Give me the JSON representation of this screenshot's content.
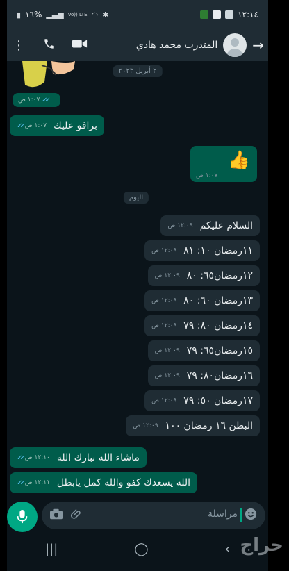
{
  "status_bar": {
    "time": "١٢:١٤",
    "battery": "١٦%",
    "network": "Vo)) LTE",
    "left_icons": [
      "battery-icon",
      "signal-icon",
      "wifi-icon",
      "bluetooth-icon"
    ],
    "right_icons": [
      "app-icon",
      "youtube-icon",
      "gallery-icon"
    ]
  },
  "header": {
    "contact_name": "المتدرب محمد هادي",
    "icons": [
      "menu-icon",
      "phone-icon",
      "video-icon",
      "back-arrow-icon"
    ]
  },
  "chat": {
    "date_chip_1": "٢ أبريل ٢٠٢٣",
    "date_chip_2": "اليوم",
    "messages": [
      {
        "dir": "out",
        "text": "",
        "time": "١:٠٧ ص",
        "kind": "sticker"
      },
      {
        "dir": "out",
        "text": "برافو عليك",
        "time": "١:٠٧ ص"
      },
      {
        "dir": "in",
        "text": "👍",
        "time": "١:٠٧ ص",
        "kind": "emoji"
      },
      {
        "dir": "in",
        "text": "السلام عليكم",
        "time": "١٢:٠٩ ص"
      },
      {
        "dir": "in",
        "text": "١١رمضان ١٠: ٨١",
        "time": "١٢:٠٩ ص"
      },
      {
        "dir": "in",
        "text": "١٢رمضان٦٥: ٨٠",
        "time": "١٢:٠٩ ص"
      },
      {
        "dir": "in",
        "text": "١٣رمضان ٦٠: ٨٠",
        "time": "١٢:٠٩ ص"
      },
      {
        "dir": "in",
        "text": "١٤رمضان ٨٠: ٧٩",
        "time": "١٢:٠٩ ص"
      },
      {
        "dir": "in",
        "text": "١٥رمضان٦٥: ٧٩",
        "time": "١٢:٠٩ ص"
      },
      {
        "dir": "in",
        "text": "١٦رمضان٨٠: ٧٩",
        "time": "١٢:٠٩ ص"
      },
      {
        "dir": "in",
        "text": "١٧رمضان ٥٠: ٧٩",
        "time": "١٢:٠٩ ص"
      },
      {
        "dir": "in",
        "text": "البطن ١٦ رمضان ١٠٠",
        "time": "١٢:٠٩ ص"
      },
      {
        "dir": "out",
        "text": "ماشاء الله تبارك الله",
        "time": "١٢:١٠ ص"
      },
      {
        "dir": "out",
        "text": "الله يسعدك كفو والله كمل يابطل",
        "time": "١٢:١١ ص"
      }
    ]
  },
  "input": {
    "placeholder": "مراسلة",
    "icons": [
      "mic-icon",
      "camera-icon",
      "attach-icon",
      "emoji-icon"
    ]
  },
  "navbar": {
    "buttons": [
      "recents-icon",
      "home-icon",
      "back-icon"
    ]
  },
  "watermark": "حراج",
  "colors": {
    "background": "#0b141a",
    "incoming_bubble": "#1f2c34",
    "outgoing_bubble": "#005c4b",
    "accent": "#00a884",
    "read_ticks": "#53bdeb"
  }
}
